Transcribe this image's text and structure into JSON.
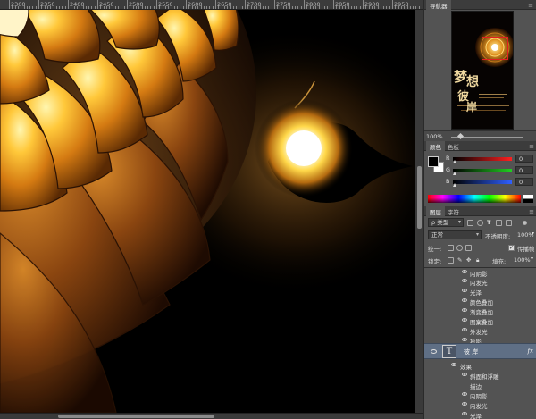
{
  "ruler": {
    "labels": [
      "2300",
      "2350",
      "2400",
      "2450",
      "2500",
      "2550",
      "2600",
      "2650",
      "2700",
      "2750",
      "2800",
      "2850",
      "2900",
      "2950"
    ]
  },
  "navigator": {
    "tab_label": "导航器",
    "zoom": "100%",
    "thumbnail_title_chars": [
      "梦",
      "想",
      "彼",
      "岸"
    ]
  },
  "color": {
    "tabs": [
      "颜色",
      "色板"
    ],
    "channels": [
      {
        "label": "R",
        "value": "0",
        "color": "#ff3030"
      },
      {
        "label": "G",
        "value": "0",
        "color": "#30d030"
      },
      {
        "label": "B",
        "value": "0",
        "color": "#3060ff"
      }
    ]
  },
  "layers": {
    "tabs": [
      "图层",
      "字符"
    ],
    "filter_kind": "ρ 类型",
    "blend_mode": "正常",
    "opacity_label": "不透明度:",
    "opacity_value": "100%",
    "unify_label": "统一:",
    "propagate_label": "传播帧",
    "lock_label": "锁定:",
    "fill_label": "填充:",
    "fill_value": "100%",
    "upper_effects": [
      "内阴影",
      "内发光",
      "光泽",
      "颜色叠加",
      "渐变叠加",
      "图案叠加",
      "外发光",
      "投影"
    ],
    "text_layer": {
      "thumb": "T",
      "name": "彼 岸",
      "fx": "fx"
    },
    "effects_label": "效果",
    "lower_effects": [
      "斜面和浮雕",
      "描边",
      "内阴影",
      "内发光",
      "光泽"
    ]
  }
}
